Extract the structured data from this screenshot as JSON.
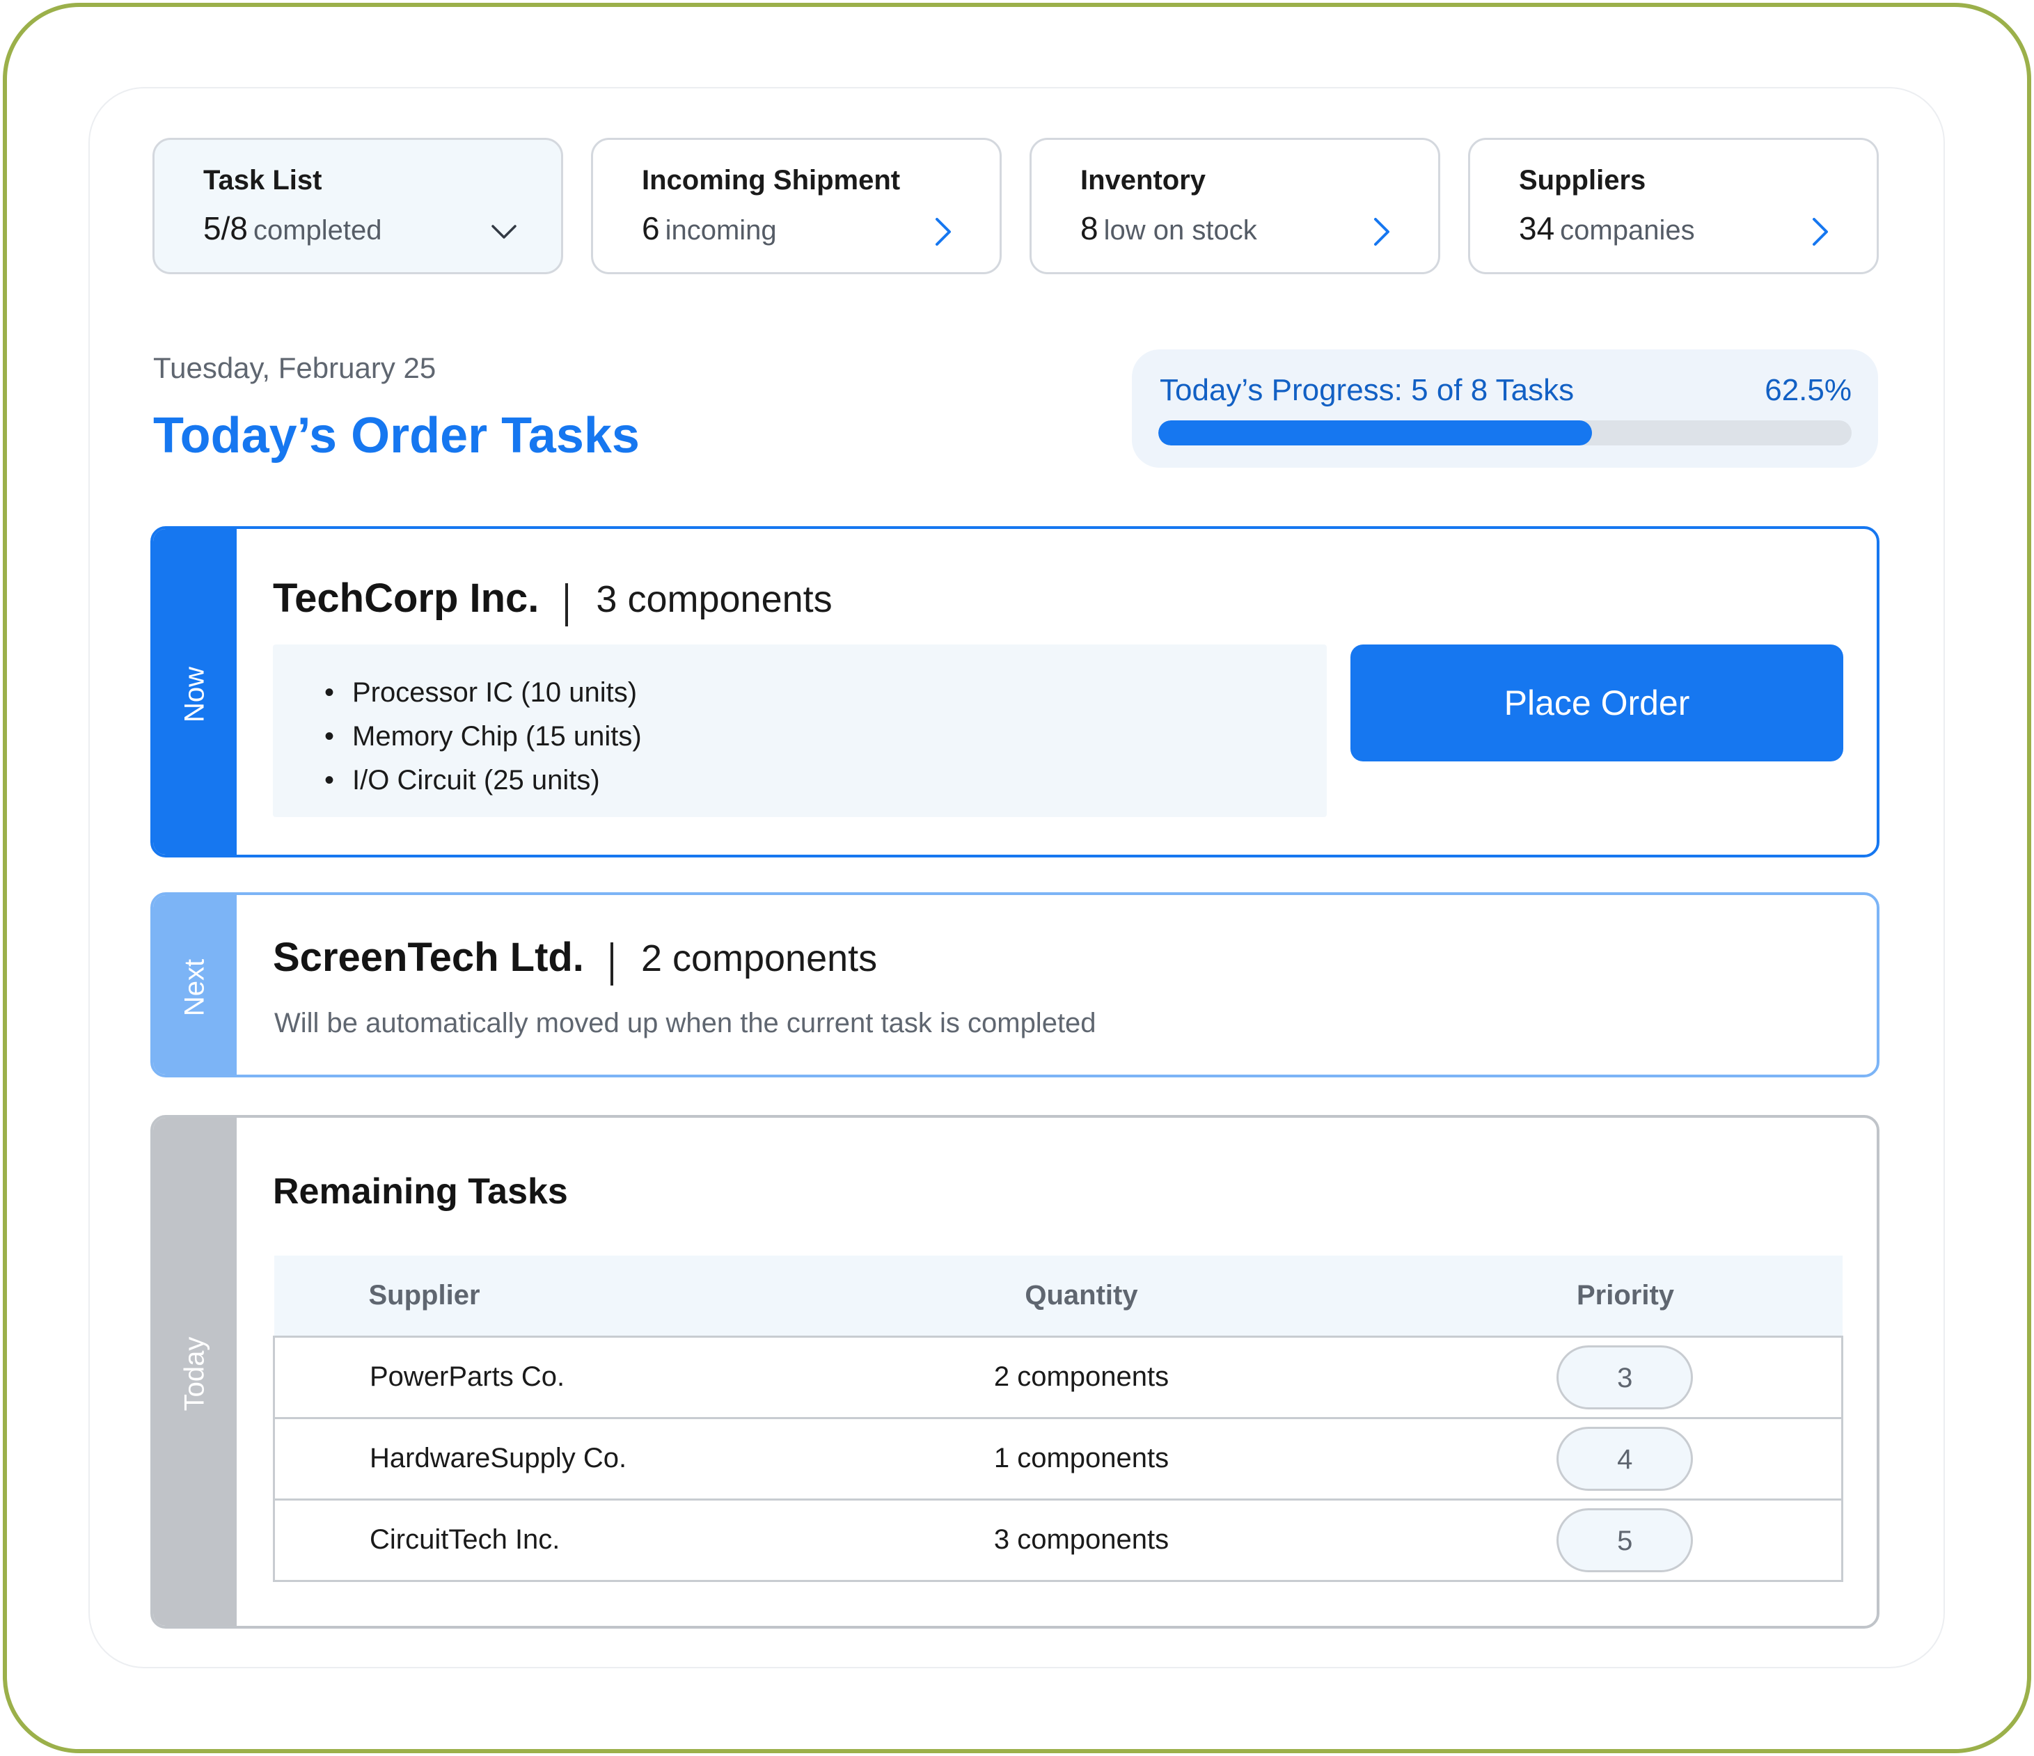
{
  "stats": [
    {
      "title": "Task List",
      "value": "5/8",
      "suffix": "completed",
      "icon": "chevron-down-icon"
    },
    {
      "title": "Incoming Shipment",
      "value": "6",
      "suffix": "incoming",
      "icon": "chevron-right-icon"
    },
    {
      "title": "Inventory",
      "value": "8",
      "suffix": "low on stock",
      "icon": "chevron-right-icon"
    },
    {
      "title": "Suppliers",
      "value": "34",
      "suffix": "companies",
      "icon": "chevron-right-icon"
    }
  ],
  "header": {
    "date": "Tuesday, February 25",
    "title": "Today’s Order Tasks"
  },
  "progress": {
    "label": "Today’s Progress: 5 of 8 Tasks",
    "percent_text": "62.5%",
    "fraction": 0.625
  },
  "now_task": {
    "tab_label": "Now",
    "supplier": "TechCorp Inc.",
    "components": "3 components",
    "items": [
      "Processor IC (10 units)",
      "Memory Chip (15 units)",
      "I/O Circuit (25 units)"
    ],
    "button_label": "Place Order"
  },
  "next_task": {
    "tab_label": "Next",
    "supplier": "ScreenTech Ltd.",
    "components": "2 components",
    "note": "Will be automatically moved up when the current task is completed"
  },
  "remaining": {
    "tab_label": "Today",
    "title": "Remaining Tasks",
    "columns": [
      "Supplier",
      "Quantity",
      "Priority"
    ],
    "rows": [
      {
        "supplier": "PowerParts Co.",
        "quantity": "2 components",
        "priority": "3"
      },
      {
        "supplier": "HardwareSupply Co.",
        "quantity": "1 components",
        "priority": "4"
      },
      {
        "supplier": "CircuitTech Inc.",
        "quantity": "3 components",
        "priority": "5"
      }
    ]
  },
  "colors": {
    "accent": "#1677f0",
    "accent_light": "#7cb4f6",
    "neutral_tab": "#c0c3c8",
    "frame": "#9bb04a"
  }
}
